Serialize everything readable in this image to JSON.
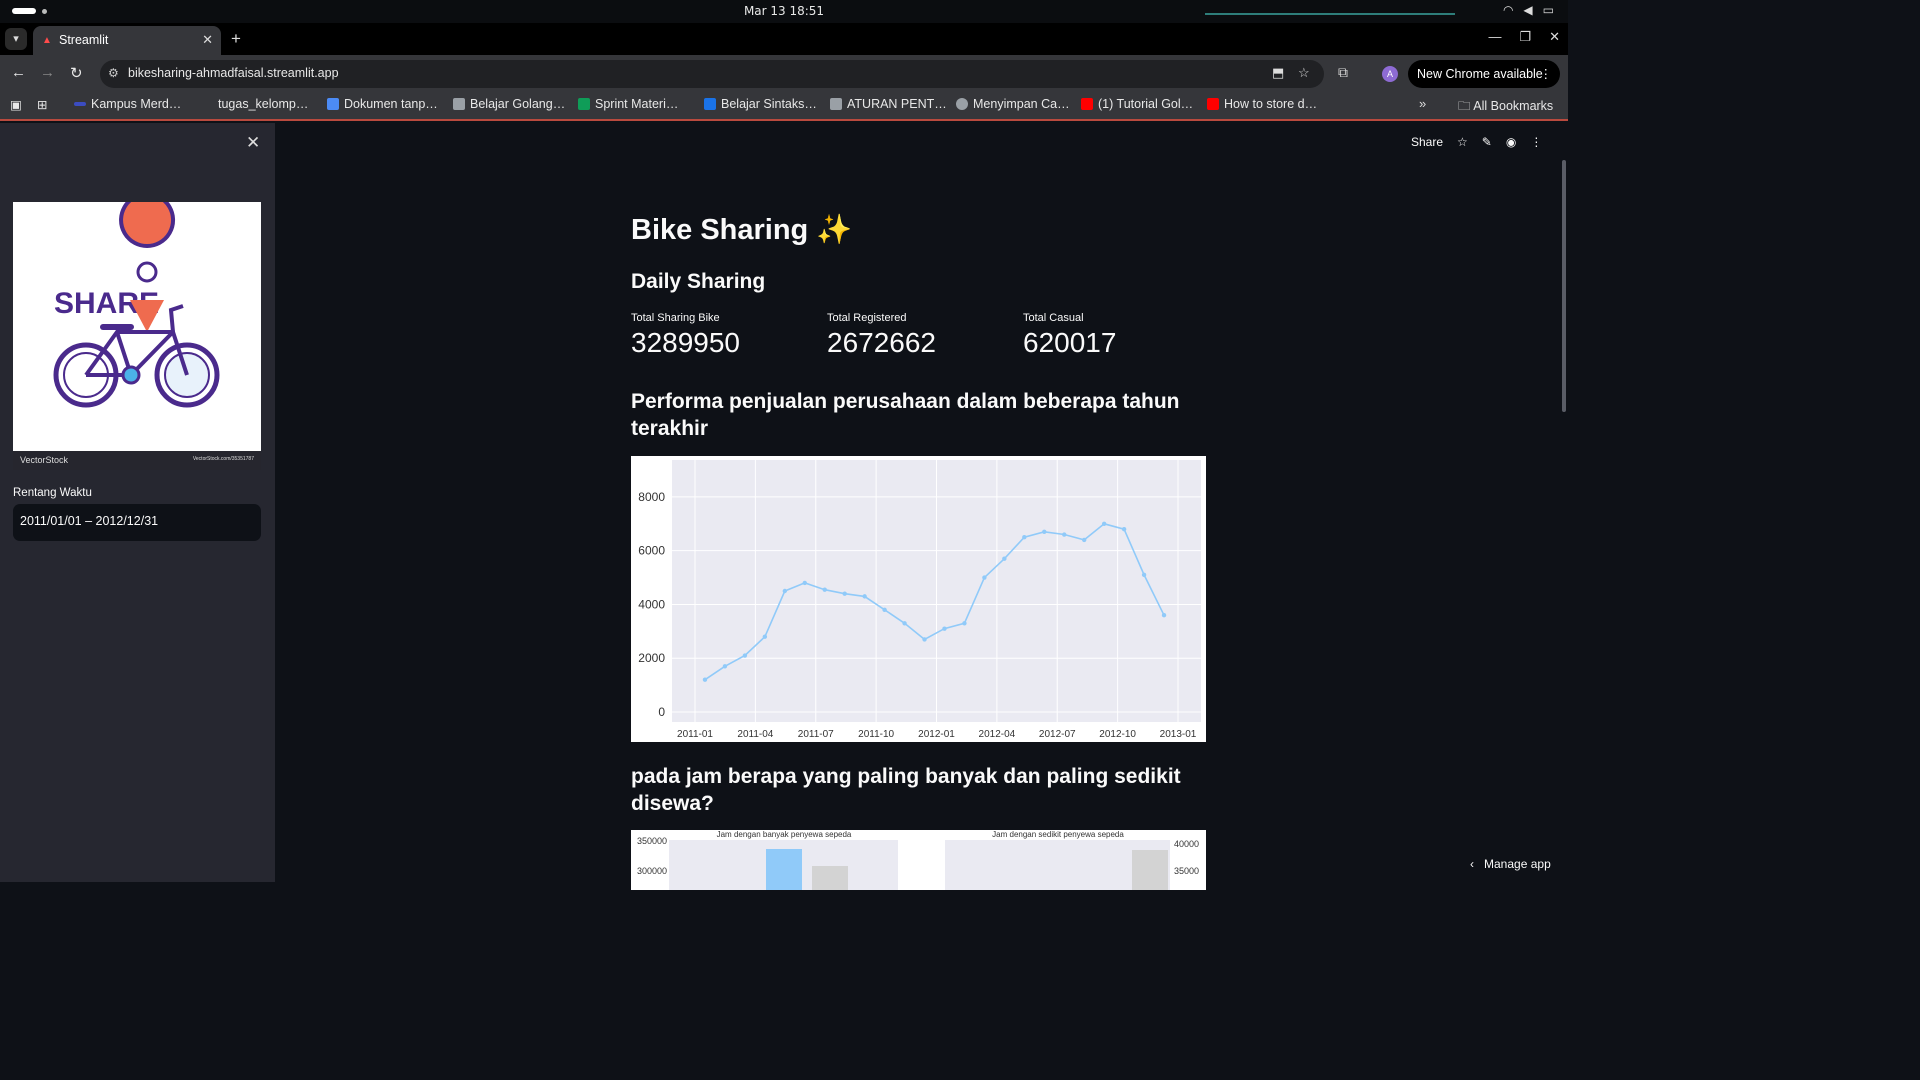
{
  "os": {
    "datetime": "Mar 13  18:51"
  },
  "browser": {
    "tab_title": "Streamlit",
    "url": "bikesharing-ahmadfaisal.streamlit.app",
    "update_button": "New Chrome available",
    "avatar_letter": "A",
    "bookmarks": [
      {
        "label": "Kampus Merd…",
        "color": "#3b4cc0"
      },
      {
        "label": "tugas_kelomp…",
        "color": "#35363a"
      },
      {
        "label": "Dokumen tanp…",
        "color": "#4c8bf5"
      },
      {
        "label": "Belajar Golang…",
        "color": "#9aa0a6"
      },
      {
        "label": "Sprint Materi…",
        "color": "#0f9d58"
      },
      {
        "label": "Belajar Sintaks…",
        "color": "#1a73e8"
      },
      {
        "label": "ATURAN PENT…",
        "color": "#9aa0a6"
      },
      {
        "label": "Menyimpan Ca…",
        "color": "#9aa0a6"
      },
      {
        "label": "(1) Tutorial Gol…",
        "color": "#ff0000"
      },
      {
        "label": "How to store d…",
        "color": "#ff0000"
      }
    ],
    "all_bookmarks": "All Bookmarks"
  },
  "sidebar": {
    "logo_text": "SHARE",
    "logo_brand": "VectorStock",
    "logo_id": "VectorStock.com/35351787",
    "range_label": "Rentang Waktu",
    "range_value": "2011/01/01 – 2012/12/31"
  },
  "toolbar": {
    "share": "Share"
  },
  "main": {
    "title": "Bike Sharing ✨",
    "daily_heading": "Daily Sharing",
    "metrics": [
      {
        "label": "Total Sharing Bike",
        "value": "3289950"
      },
      {
        "label": "Total Registered",
        "value": "2672662"
      },
      {
        "label": "Total Casual",
        "value": "620017"
      }
    ],
    "performance_heading": "Performa penjualan perusahaan dalam beberapa tahun terakhir",
    "hours_heading": "pada jam berapa yang paling banyak dan paling sedikit disewa?",
    "manage_app": "Manage app"
  },
  "chart_data": [
    {
      "type": "line",
      "title": "",
      "xlabel": "",
      "ylabel": "",
      "x_ticks": [
        "2011-01",
        "2011-04",
        "2011-07",
        "2011-10",
        "2012-01",
        "2012-04",
        "2012-07",
        "2012-10",
        "2013-01"
      ],
      "y_ticks": [
        0,
        2000,
        4000,
        6000,
        8000
      ],
      "ylim": [
        0,
        9000
      ],
      "color": "#90caf9",
      "background": "#eaeaf2",
      "series": [
        {
          "x": [
            "2011-01",
            "2011-02",
            "2011-03",
            "2011-04",
            "2011-05",
            "2011-06",
            "2011-07",
            "2011-08",
            "2011-09",
            "2011-10",
            "2011-11",
            "2011-12",
            "2012-01",
            "2012-02",
            "2012-03",
            "2012-04",
            "2012-05",
            "2012-06",
            "2012-07",
            "2012-08",
            "2012-09",
            "2012-10",
            "2012-11",
            "2012-12"
          ],
          "values": [
            1200,
            1700,
            2100,
            2800,
            4500,
            4800,
            4550,
            4400,
            4300,
            3800,
            3300,
            2700,
            3100,
            3300,
            5000,
            5700,
            6500,
            6700,
            6600,
            6400,
            7000,
            6800,
            5100,
            3600
          ]
        }
      ]
    },
    {
      "type": "bar",
      "title": "Jam dengan banyak penyewa sepeda",
      "y_ticks": [
        300000,
        350000
      ]
    },
    {
      "type": "bar",
      "title": "Jam dengan sedikit penyewa sepeda",
      "y_ticks": [
        35000,
        40000
      ]
    }
  ]
}
